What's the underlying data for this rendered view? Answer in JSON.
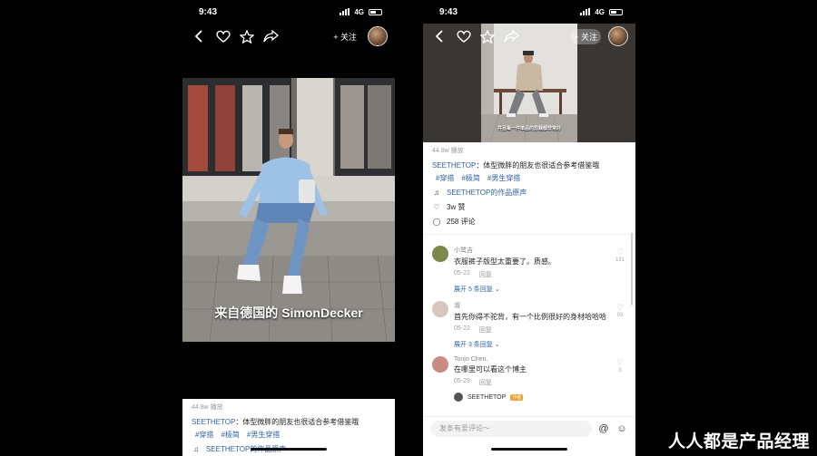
{
  "status_bar": {
    "time": "9:43",
    "network": "4G"
  },
  "top_bar": {
    "follow_label": "+ 关注"
  },
  "video": {
    "caption": "来自德国的 SimonDecker",
    "small_caption": "并且每一件单品的剪裁都非常好"
  },
  "post": {
    "plays": "44.8w 播放",
    "author": "SEETHETOP",
    "text": "：体型微胖的朋友也很适合参考借鉴哦",
    "tags": [
      "#穿搭",
      "#极简",
      "#男生穿搭"
    ],
    "music": "SEETHETOP的作品原声",
    "likes": "3w 赞",
    "comments_count": "258 评论"
  },
  "comments": [
    {
      "user": "小鹭吉",
      "text": "衣服裤子版型太重要了。质感。",
      "date": "05-22",
      "reply_label": "回复",
      "expand": "展开 5 条回复",
      "likes": "131",
      "avatar_color": "#7a8a4a"
    },
    {
      "user": "淑",
      "text": "首先你得不驼背，有一个比例很好的身材哈哈哈",
      "date": "05-22",
      "reply_label": "回复",
      "expand": "展开 3 条回复",
      "likes": "93",
      "avatar_color": "#d8c7c0"
    },
    {
      "user": "Tonjo Chen.",
      "text": "在哪里可以看这个博主",
      "date": "05-29",
      "reply_label": "回复",
      "expand": "",
      "likes": "3",
      "avatar_color": "#c98b84"
    }
  ],
  "reply_preview": {
    "user": "SEETHETOP",
    "badge": "作者"
  },
  "input": {
    "placeholder": "发条有爱评论～"
  },
  "watermark": "人人都是产品经理",
  "icons": [
    "back-icon",
    "heart-icon",
    "star-icon",
    "share-icon",
    "music-icon",
    "like-icon",
    "comment-icon",
    "at-icon",
    "emoji-icon"
  ],
  "colors": {
    "link": "#2f5fa8",
    "background": "#000000",
    "sheet": "#ffffff"
  }
}
